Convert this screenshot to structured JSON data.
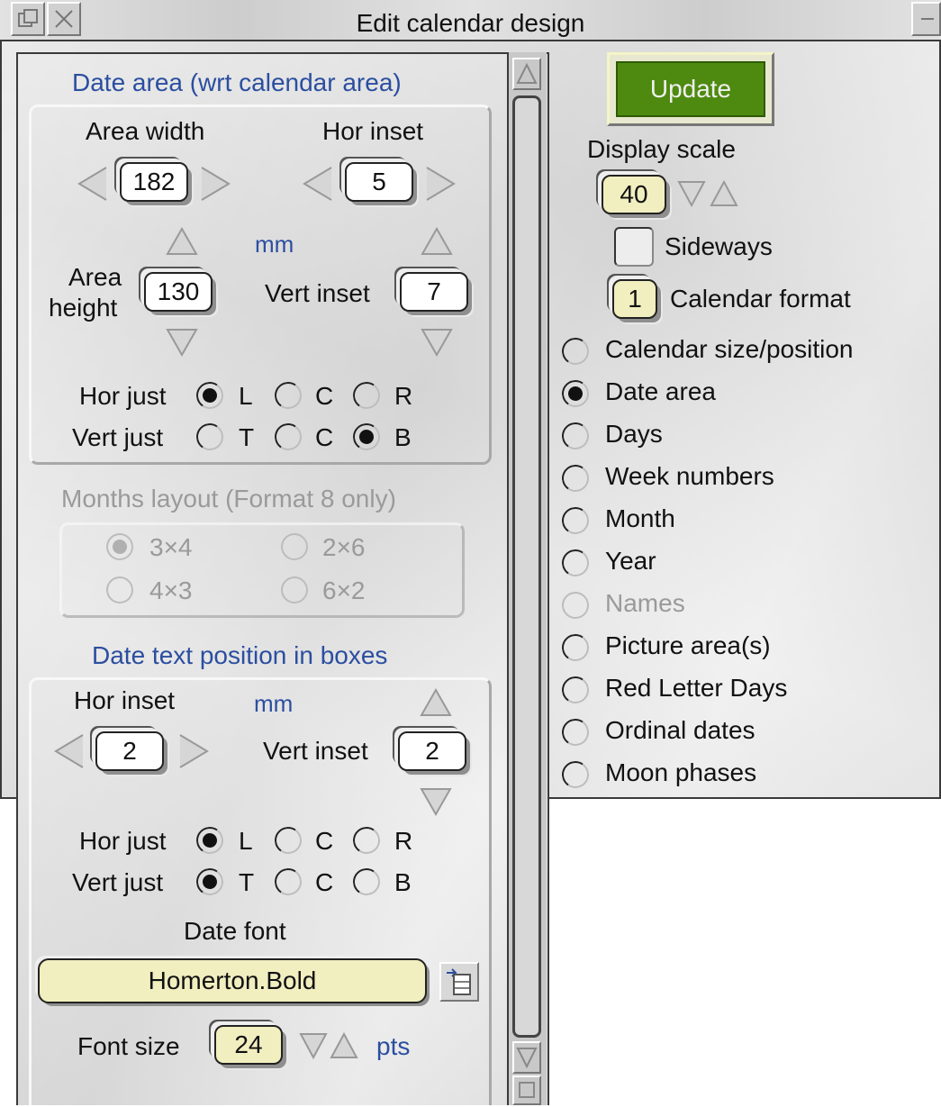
{
  "window": {
    "title": "Edit calendar design"
  },
  "date_area": {
    "heading": "Date area (wrt calendar area)",
    "area_width_label": "Area width",
    "area_width": "182",
    "hor_inset_label": "Hor inset",
    "hor_inset": "5",
    "units": "mm",
    "area_height_label_1": "Area",
    "area_height_label_2": "height",
    "area_height": "130",
    "vert_inset_label": "Vert inset",
    "vert_inset": "7",
    "hor_just_label": "Hor just",
    "vert_just_label": "Vert just",
    "hor_options": [
      "L",
      "C",
      "R"
    ],
    "vert_options": [
      "T",
      "C",
      "B"
    ],
    "hor_selected": "L",
    "vert_selected": "B"
  },
  "months_layout": {
    "heading": "Months layout  (Format 8 only)",
    "options": [
      "3×4",
      "2×6",
      "4×3",
      "6×2"
    ],
    "selected": "3×4",
    "enabled": false
  },
  "date_text": {
    "heading": "Date text position in boxes",
    "hor_inset_label": "Hor inset",
    "units": "mm",
    "hor_inset": "2",
    "vert_inset_label": "Vert inset",
    "vert_inset": "2",
    "hor_just_label": "Hor just",
    "vert_just_label": "Vert just",
    "hor_options": [
      "L",
      "C",
      "R"
    ],
    "vert_options": [
      "T",
      "C",
      "B"
    ],
    "hor_selected": "L",
    "vert_selected": "T",
    "date_font_label": "Date font",
    "date_font": "Homerton.Bold",
    "font_size_label": "Font size",
    "font_size": "24",
    "font_units": "pts"
  },
  "controls": {
    "update_label": "Update",
    "display_scale_label": "Display scale",
    "display_scale": "40",
    "sideways_label": "Sideways",
    "sideways_checked": false,
    "calendar_format_value": "1",
    "calendar_format_label": "Calendar format"
  },
  "sections": {
    "items": [
      "Calendar size/position",
      "Date area",
      "Days",
      "Week numbers",
      "Month",
      "Year",
      "Names",
      "Picture area(s)",
      "Red Letter Days",
      "Ordinal dates",
      "Moon phases"
    ],
    "selected": "Date area",
    "disabled": [
      "Names"
    ]
  },
  "colors": {
    "update_button": "#4f8a10",
    "heading_blue": "#2b4ea0",
    "field_yellow": "#f1eec0"
  }
}
